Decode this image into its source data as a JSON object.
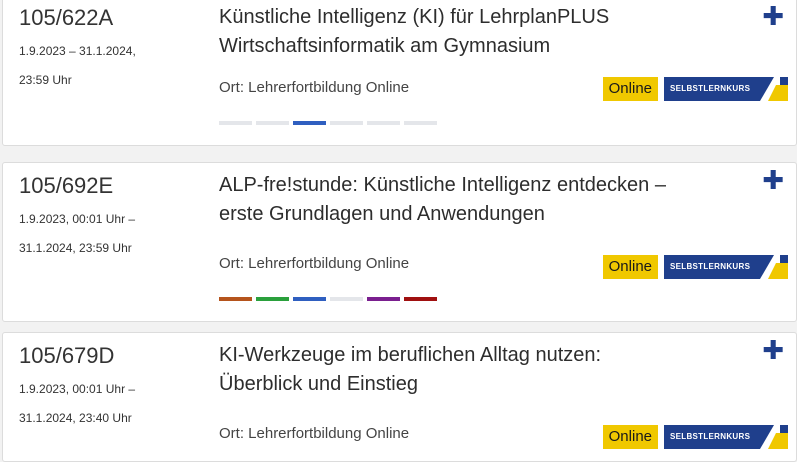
{
  "courses": [
    {
      "id": "105/622A",
      "date_line1": "1.9.2023 – 31.1.2024,",
      "date_line2": "23:59 Uhr",
      "title_line1": "Künstliche Intelligenz (KI) für LehrplanPLUS",
      "title_line2": "Wirtschaftsinformatik am Gymnasium",
      "place": "Ort: Lehrerfortbildung Online",
      "format": "Online",
      "type": "SELBSTLERNKURS",
      "add_icon": "plus-icon",
      "subject_colors": [
        "#e4e6ea",
        "#e4e6ea",
        "#2f5fc0",
        "#e4e6ea",
        "#e4e6ea",
        "#e4e6ea"
      ]
    },
    {
      "id": "105/692E",
      "date_line1": "1.9.2023, 00:01 Uhr –",
      "date_line2": "31.1.2024, 23:59 Uhr",
      "title_line1": "ALP-fre!stunde: Künstliche Intelligenz entdecken –",
      "title_line2": "erste Grundlagen und Anwendungen",
      "place": "Ort: Lehrerfortbildung Online",
      "format": "Online",
      "type": "SELBSTLERNKURS",
      "add_icon": "plus-icon",
      "subject_colors": [
        "#b5541c",
        "#2aa03c",
        "#2f5fc0",
        "#e4e6ea",
        "#7a1f8f",
        "#a01010"
      ]
    },
    {
      "id": "105/679D",
      "date_line1": "1.9.2023, 00:01 Uhr –",
      "date_line2": "31.1.2024, 23:40 Uhr",
      "title_line1": "KI-Werkzeuge im beruflichen Alltag nutzen:",
      "title_line2": "Überblick und Einstieg",
      "place": "Ort: Lehrerfortbildung Online",
      "format": "Online",
      "type": "SELBSTLERNKURS",
      "add_icon": "plus-icon"
    }
  ],
  "colors": {
    "brand_blue": "#1f3f8c",
    "online_yellow": "#f0c800"
  }
}
